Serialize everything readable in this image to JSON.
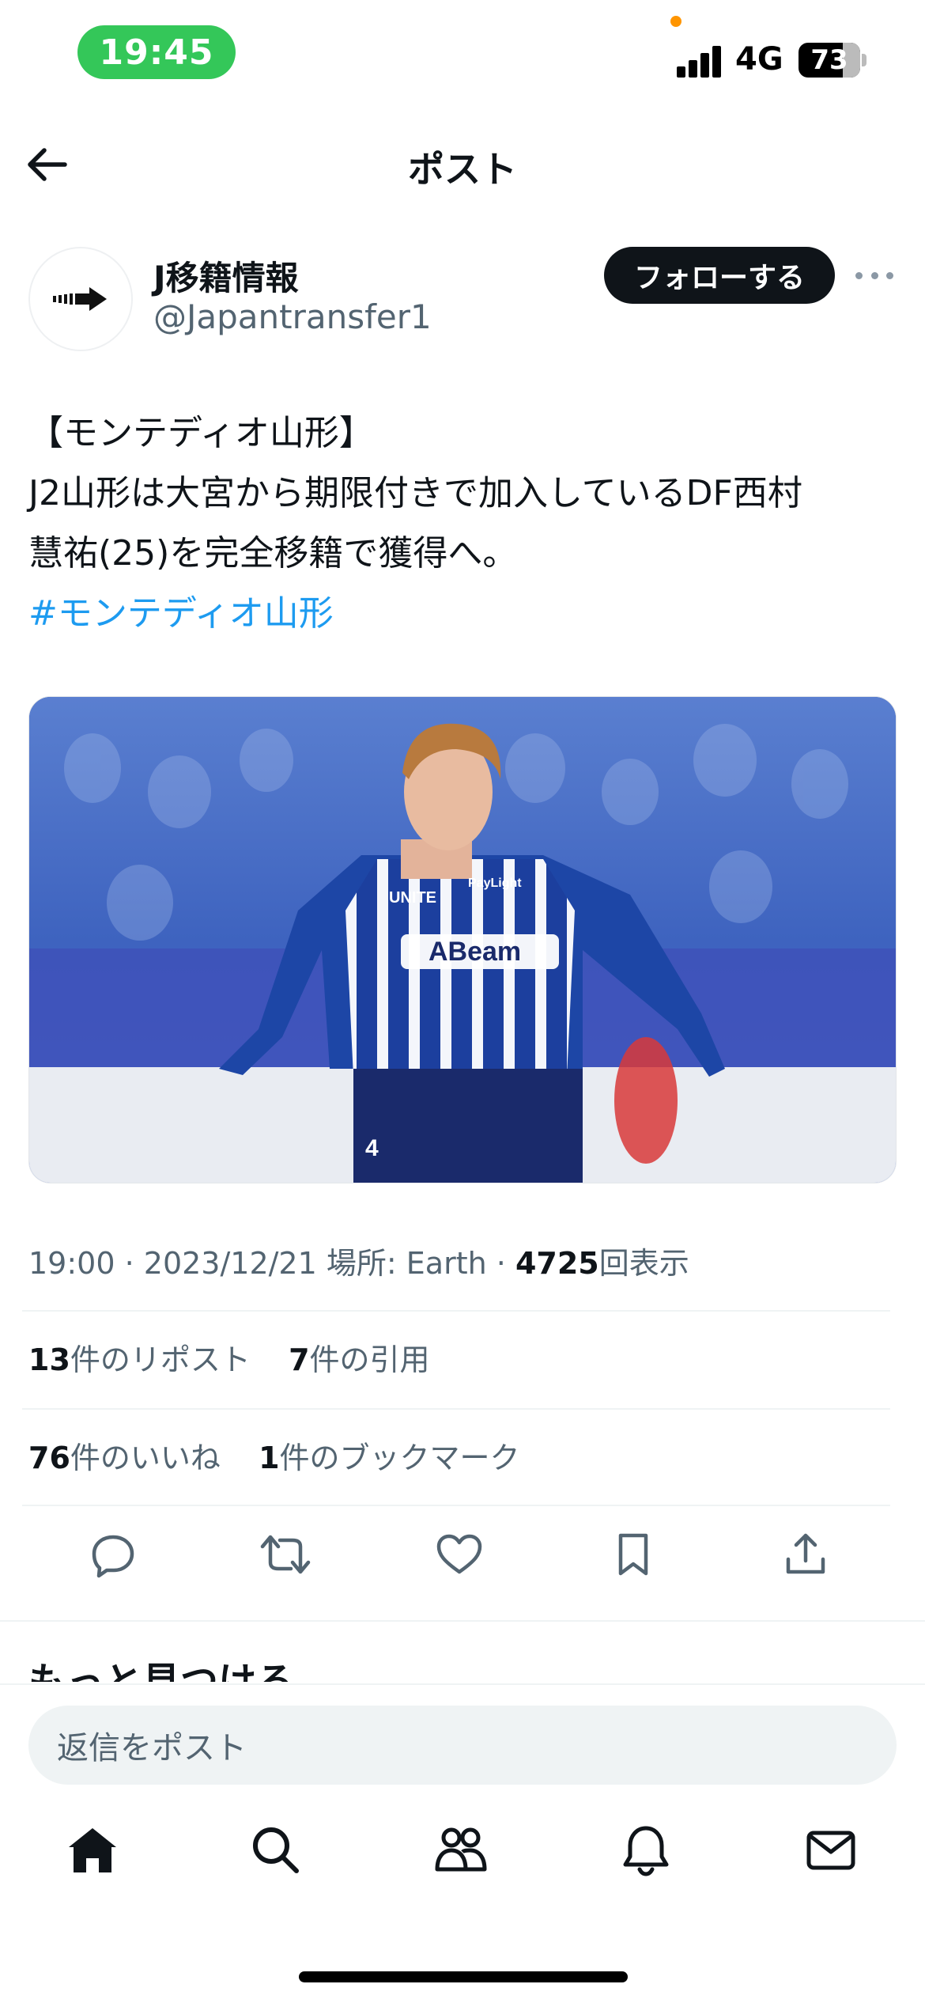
{
  "status_bar": {
    "time": "19:45",
    "network": "4G",
    "battery": "73"
  },
  "header": {
    "title": "ポスト"
  },
  "author": {
    "name": "J移籍情報",
    "handle": "@Japantransfer1"
  },
  "follow_button": "フォローする",
  "post": {
    "lines": [
      "【モンテディオ山形】",
      "J2山形は大宮から期限付きで加入しているDF西村",
      "慧祐(25)を完全移籍で獲得へ。"
    ],
    "hashtag": "#モンテディオ山形"
  },
  "image_text": {
    "sponsor": "ABeam",
    "badge": "PayLight",
    "brand": "UNITE",
    "number": "4"
  },
  "meta": {
    "time": "19:00",
    "date": "2023/12/21",
    "place": "場所: Earth",
    "views": "4725",
    "views_label": "回表示"
  },
  "stats": {
    "reposts": "13",
    "reposts_label": "件のリポスト",
    "quotes": "7",
    "quotes_label": "件の引用",
    "likes": "76",
    "likes_label": "件のいいね",
    "bookmarks": "1",
    "bookmarks_label": "件のブックマーク"
  },
  "more_section": "もっと見つける",
  "reply": {
    "placeholder": "返信をポスト"
  },
  "icons": [
    "back-arrow-icon",
    "arrow-logo-icon",
    "more-icon",
    "reply-icon",
    "repost-icon",
    "like-icon",
    "bookmark-icon",
    "share-icon",
    "home-icon",
    "search-icon",
    "communities-icon",
    "notifications-icon",
    "messages-icon"
  ],
  "colors": {
    "accent": "#1d9bf0",
    "status_green": "#34c759",
    "text": "#0f1419",
    "muted": "#536471"
  }
}
